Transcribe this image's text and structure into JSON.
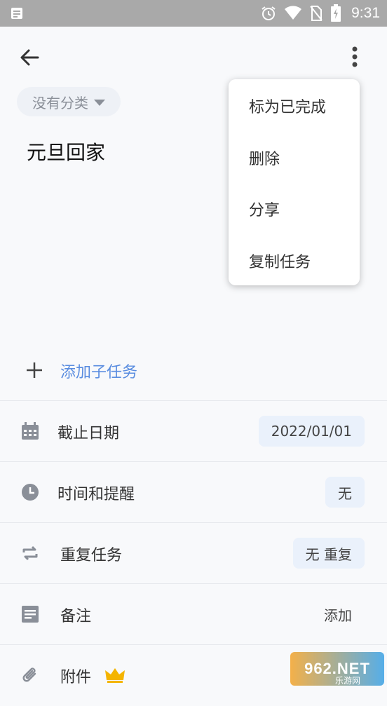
{
  "status_bar": {
    "time": "9:31"
  },
  "header": {
    "category_chip": "没有分类"
  },
  "task": {
    "title": "元旦回家"
  },
  "menu": {
    "items": [
      "标为已完成",
      "删除",
      "分享",
      "复制任务"
    ]
  },
  "subtask": {
    "label": "添加子任务"
  },
  "rows": {
    "due": {
      "label": "截止日期",
      "value": "2022/01/01"
    },
    "reminder": {
      "label": "时间和提醒",
      "value": "无"
    },
    "repeat": {
      "label": "重复任务",
      "value": "无 重复"
    },
    "note": {
      "label": "备注",
      "value": "添加"
    },
    "attachment": {
      "label": "附件"
    }
  },
  "watermark": {
    "text": "962.NET",
    "sub": "乐游网"
  },
  "colors": {
    "accent": "#5a8de0",
    "chip_bg": "#eef1f6",
    "value_bg": "#eaf1fb",
    "crown": "#f4b400"
  }
}
